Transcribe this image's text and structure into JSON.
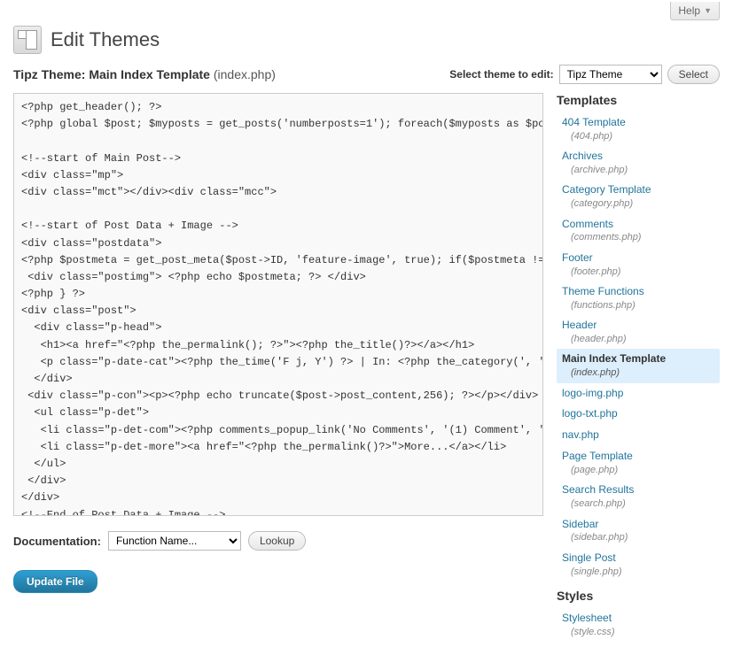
{
  "help_label": "Help",
  "page_title": "Edit Themes",
  "theme_name": "Tipz Theme:",
  "current_template": "Main Index Template",
  "current_filename": "(index.php)",
  "select_theme_label": "Select theme to edit:",
  "theme_dropdown_value": "Tipz Theme",
  "select_button": "Select",
  "code": "<?php get_header(); ?>\n<?php global $post; $myposts = get_posts('numberposts=1'); foreach($myposts as $post) : setup_postdata($post); ?>\n\n<!--start of Main Post-->\n<div class=\"mp\">\n<div class=\"mct\"></div><div class=\"mcc\">\n\n<!--start of Post Data + Image -->\n<div class=\"postdata\">\n<?php $postmeta = get_post_meta($post->ID, 'feature-image', true); if($postmeta != \"\"){ ?>\n <div class=\"postimg\"> <?php echo $postmeta; ?> </div>\n<?php } ?>\n<div class=\"post\">\n  <div class=\"p-head\">\n   <h1><a href=\"<?php the_permalink(); ?>\"><?php the_title()?></a></h1>\n   <p class=\"p-date-cat\"><?php the_time('F j, Y') ?> | In: <?php the_category(', ') ?></p>\n  </div>\n <div class=\"p-con\"><p><?php echo truncate($post->post_content,256); ?></p></div>\n  <ul class=\"p-det\">\n   <li class=\"p-det-com\"><?php comments_popup_link('No Comments', '(1) Comment', '(%) Comments'); ?></li>\n   <li class=\"p-det-more\"><a href=\"<?php the_permalink()?>\">More...</a></li>\n  </ul>\n </div>\n</div>\n<!--End of Post Data + Image -->\n",
  "doc_label": "Documentation:",
  "doc_dropdown_value": "Function Name...",
  "lookup_button": "Lookup",
  "update_button": "Update File",
  "sidebar": {
    "templates_heading": "Templates",
    "styles_heading": "Styles",
    "templates": [
      {
        "label": "404 Template",
        "file": "(404.php)",
        "active": false
      },
      {
        "label": "Archives",
        "file": "(archive.php)",
        "active": false
      },
      {
        "label": "Category Template",
        "file": "(category.php)",
        "active": false
      },
      {
        "label": "Comments",
        "file": "(comments.php)",
        "active": false
      },
      {
        "label": "Footer",
        "file": "(footer.php)",
        "active": false
      },
      {
        "label": "Theme Functions",
        "file": "(functions.php)",
        "active": false
      },
      {
        "label": "Header",
        "file": "(header.php)",
        "active": false
      },
      {
        "label": "Main Index Template",
        "file": "(index.php)",
        "active": true
      },
      {
        "label": "logo-img.php",
        "file": "",
        "active": false
      },
      {
        "label": "logo-txt.php",
        "file": "",
        "active": false
      },
      {
        "label": "nav.php",
        "file": "",
        "active": false
      },
      {
        "label": "Page Template",
        "file": "(page.php)",
        "active": false
      },
      {
        "label": "Search Results",
        "file": "(search.php)",
        "active": false
      },
      {
        "label": "Sidebar",
        "file": "(sidebar.php)",
        "active": false
      },
      {
        "label": "Single Post",
        "file": "(single.php)",
        "active": false
      }
    ],
    "styles": [
      {
        "label": "Stylesheet",
        "file": "(style.css)",
        "active": false
      }
    ]
  }
}
